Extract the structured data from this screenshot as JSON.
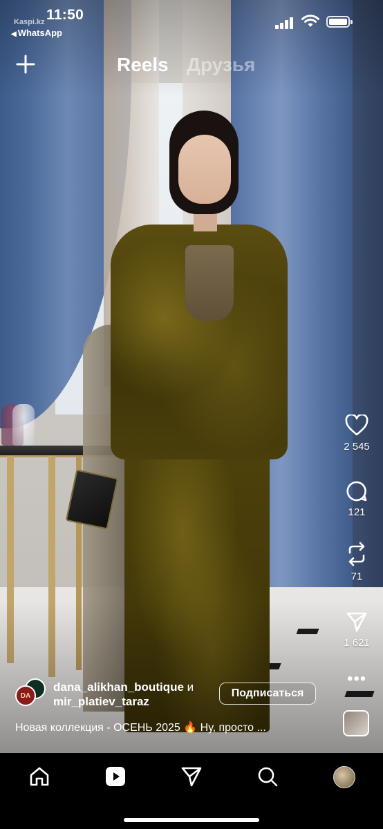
{
  "status_bar": {
    "time": "11:50",
    "back_app": "WhatsApp",
    "watermark": "Kaspi.kz"
  },
  "header": {
    "tabs": [
      {
        "label": "Reels",
        "active": true
      },
      {
        "label": "Друзья",
        "active": false
      }
    ],
    "create_icon": "plus-icon"
  },
  "actions": {
    "likes": "2 545",
    "comments": "121",
    "reposts": "71",
    "shares": "1 621"
  },
  "post": {
    "author_primary": "dana_alikhan_boutique",
    "author_joiner": "и",
    "author_secondary": "mir_platiev_taraz",
    "avatar_text": "DA",
    "follow_label": "Подписаться",
    "caption": "Новая коллекция - ОСЕНЬ 2025 🔥 Ну, просто ..."
  },
  "bottom_nav": {
    "items": [
      "home-icon",
      "reels-icon",
      "send-icon",
      "search-icon",
      "profile-avatar"
    ]
  },
  "colors": {
    "background": "#000000",
    "text": "#ffffff",
    "inactive_tab": "#ffffff73"
  }
}
